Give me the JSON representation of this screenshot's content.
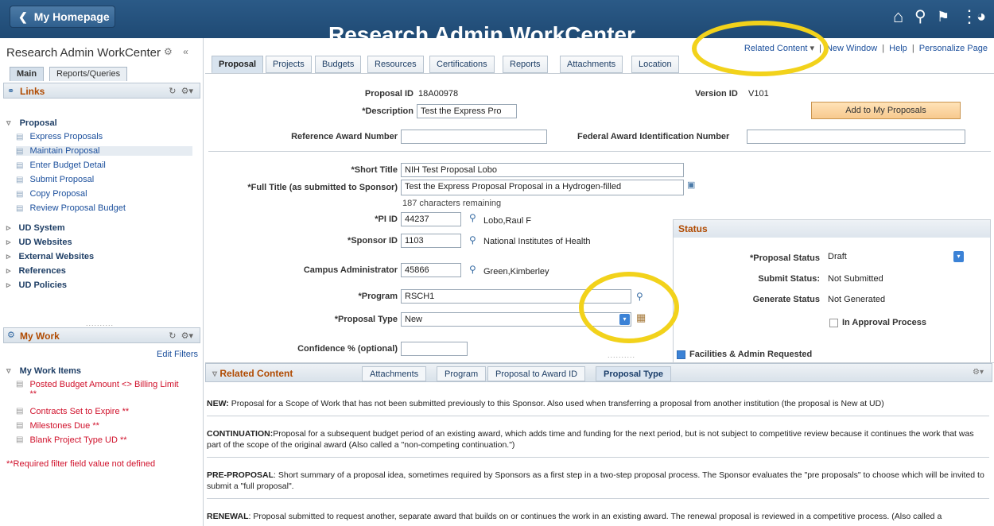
{
  "banner": {
    "home_label": "My Homepage",
    "title": "Research Admin WorkCenter"
  },
  "left": {
    "title": "Research Admin WorkCenter",
    "tabs": [
      "Main",
      "Reports/Queries"
    ],
    "links_title": "Links",
    "proposal_group": "Proposal",
    "proposal_links": [
      "Express Proposals",
      "Maintain Proposal",
      "Enter Budget Detail",
      "Submit Proposal",
      "Copy Proposal",
      "Review Proposal Budget"
    ],
    "groups": [
      "UD System",
      "UD Websites",
      "External Websites",
      "References",
      "UD Policies"
    ],
    "mywork_title": "My Work",
    "edit_filters": "Edit Filters",
    "work_items_title": "My Work Items",
    "work_items": [
      "Posted Budget Amount <> Billing Limit **",
      "Contracts Set to Expire **",
      "Milestones Due **",
      "Blank Project Type UD **"
    ],
    "required_note": "**Required filter field value not defined"
  },
  "toplinks": {
    "related": "Related Content",
    "new_window": "New Window",
    "help": "Help",
    "personalize": "Personalize Page"
  },
  "tabs": [
    "Proposal",
    "Projects",
    "Budgets",
    "Resources",
    "Certifications",
    "Reports",
    "Attachments",
    "Location"
  ],
  "form": {
    "proposal_id_label": "Proposal ID",
    "proposal_id": "18A00978",
    "version_id_label": "Version ID",
    "version_id": "V101",
    "description_label": "*Description",
    "description": "Test the Express Pro",
    "add_button": "Add to My Proposals",
    "ref_award_label": "Reference Award Number",
    "fed_award_label": "Federal Award Identification Number",
    "short_title_label": "*Short Title",
    "short_title": "NIH Test Proposal Lobo",
    "full_title_label": "*Full Title (as submitted to Sponsor)",
    "full_title": "Test the Express Proposal Proposal in a Hydrogen-filled",
    "chars_remaining": "187 characters remaining",
    "pi_label": "*PI ID",
    "pi_id": "44237",
    "pi_name": "Lobo,Raul F",
    "sponsor_label": "*Sponsor ID",
    "sponsor_id": "1103",
    "sponsor_name": "National Institutes of Health",
    "campus_admin_label": "Campus Administrator",
    "campus_admin_id": "45866",
    "campus_admin_name": "Green,Kimberley",
    "program_label": "*Program",
    "program": "RSCH1",
    "proposal_type_label": "*Proposal Type",
    "proposal_type": "New",
    "confidence_label": "Confidence % (optional)"
  },
  "status": {
    "title": "Status",
    "proposal_status_label": "*Proposal Status",
    "proposal_status": "Draft",
    "submit_status_label": "Submit Status:",
    "submit_status": "Not Submitted",
    "generate_status_label": "Generate Status",
    "generate_status": "Not Generated",
    "approval_label": "In Approval Process",
    "facilities_label": "Facilities & Admin Requested"
  },
  "related": {
    "title": "Related Content",
    "tabs": [
      "Attachments",
      "Program",
      "Proposal to Award ID",
      "Proposal Type"
    ],
    "paragraphs": [
      {
        "head": "NEW:",
        "text": " Proposal for a Scope of Work that has not been submitted previously to this Sponsor. Also used when transferring a proposal from another institution (the proposal is New at UD)"
      },
      {
        "head": "CONTINUATION:",
        "text": "Proposal for a subsequent budget period of an existing award, which adds time and funding for the next period, but is not subject to competitive review because it continues the work that was part of the scope of the original award (Also called a \"non-competing continuation.\")"
      },
      {
        "head": "PRE-PROPOSAL",
        "text": ": Short summary of a proposal idea, sometimes required by Sponsors as a first step in a two-step proposal process. The Sponsor evaluates the \"pre proposals\" to choose which will be invited to submit a \"full proposal\"."
      },
      {
        "head": "RENEWAL",
        "text": ": Proposal submitted to request another, separate award that builds on or continues the work in an existing award. The renewal proposal is reviewed in a competitive process. (Also called a"
      }
    ]
  },
  "colors": {
    "banner": "#1f4a74",
    "accent_orange": "#b04a00",
    "link_blue": "#1b4f9c",
    "alert_red": "#d0112b",
    "highlight_yellow": "#f2d21b"
  }
}
